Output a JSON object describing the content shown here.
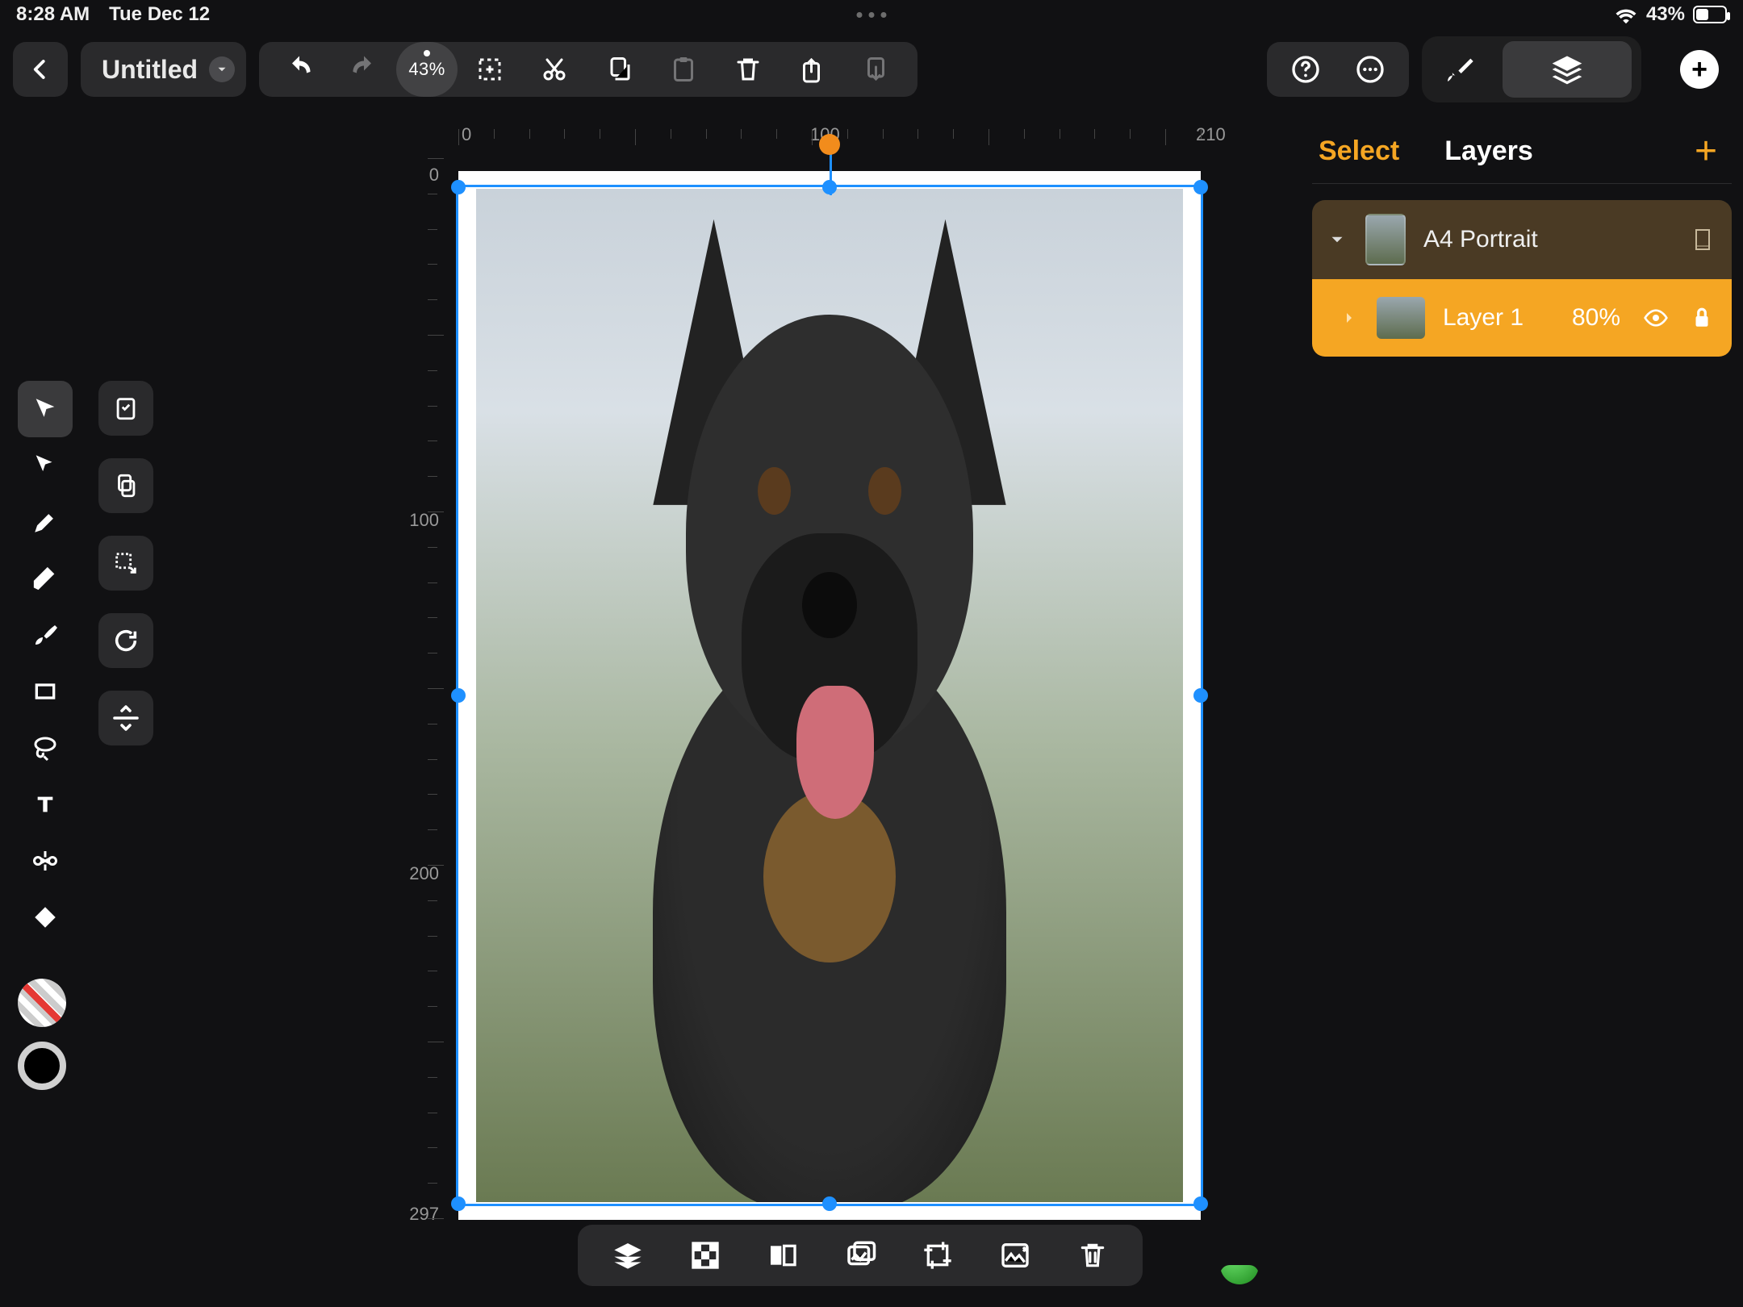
{
  "status": {
    "time": "8:28 AM",
    "date": "Tue Dec 12",
    "battery_pct": "43%"
  },
  "toolbar": {
    "title": "Untitled",
    "zoom": "43%"
  },
  "ruler": {
    "h": {
      "t0": "0",
      "t100": "100",
      "t210": "210"
    },
    "v": {
      "t0": "0",
      "t100": "100",
      "t200": "200",
      "t297": "297"
    }
  },
  "sidebar": {
    "tab_select": "Select",
    "tab_layers": "Layers",
    "group_name": "A4 Portrait",
    "layer_name": "Layer 1",
    "layer_opacity": "80%"
  }
}
